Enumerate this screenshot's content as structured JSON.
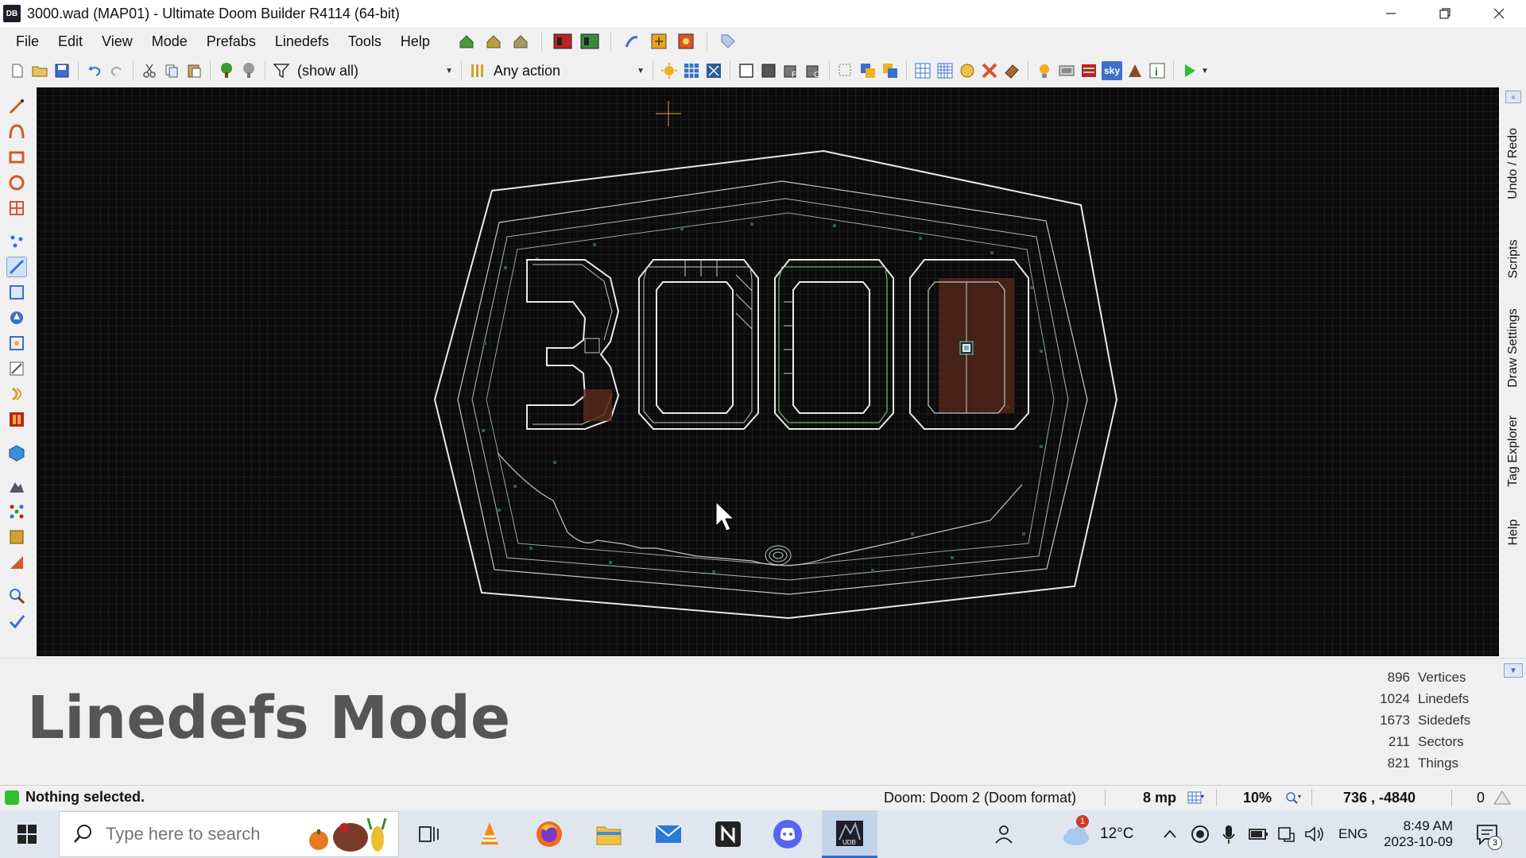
{
  "window": {
    "logo": "DB",
    "title": "3000.wad (MAP01) - Ultimate Doom Builder R4114 (64-bit)",
    "minimize_icon": "minimize-icon",
    "restore_icon": "restore-icon",
    "close_icon": "close-icon"
  },
  "menu": {
    "items": [
      "File",
      "Edit",
      "View",
      "Mode",
      "Prefabs",
      "Linedefs",
      "Tools",
      "Help"
    ]
  },
  "toolbar": {
    "filter_value": "(show all)",
    "action_value": "Any action",
    "sky_label": "sky"
  },
  "map": {
    "digits": [
      "3",
      "0",
      "0",
      "0"
    ],
    "colors": {
      "background": "#0b0b0b",
      "grid": "#1a1a1a",
      "linedef": "#e8e8e8",
      "inner_line": "#bfc8c8",
      "thing_dot": "#2d5a55",
      "crosshair": "#d8a34a",
      "green_line": "#8fd18f",
      "sector_fill": "#5a2a1e"
    }
  },
  "right_dock": {
    "tabs": [
      "Undo / Redo",
      "Scripts",
      "Draw Settings",
      "Tag Explorer",
      "Help"
    ]
  },
  "info": {
    "mode_title": "Linedefs Mode",
    "stats": [
      {
        "count": "896",
        "label": "Vertices"
      },
      {
        "count": "1024",
        "label": "Linedefs"
      },
      {
        "count": "1673",
        "label": "Sidedefs"
      },
      {
        "count": "211",
        "label": "Sectors"
      },
      {
        "count": "821",
        "label": "Things"
      }
    ]
  },
  "status": {
    "message": "Nothing selected.",
    "game_config": "Doom: Doom 2 (Doom format)",
    "grid_size": "8 mp",
    "zoom": "10%",
    "coordinates": "736 , -4840",
    "counter": "0"
  },
  "taskbar": {
    "search_placeholder": "Type here to search",
    "weather_temp": "12°C",
    "weather_badge": "1",
    "language": "ENG",
    "time": "8:49 AM",
    "date": "2023-10-09",
    "notification_count": "3",
    "udb_label": "UDB"
  }
}
